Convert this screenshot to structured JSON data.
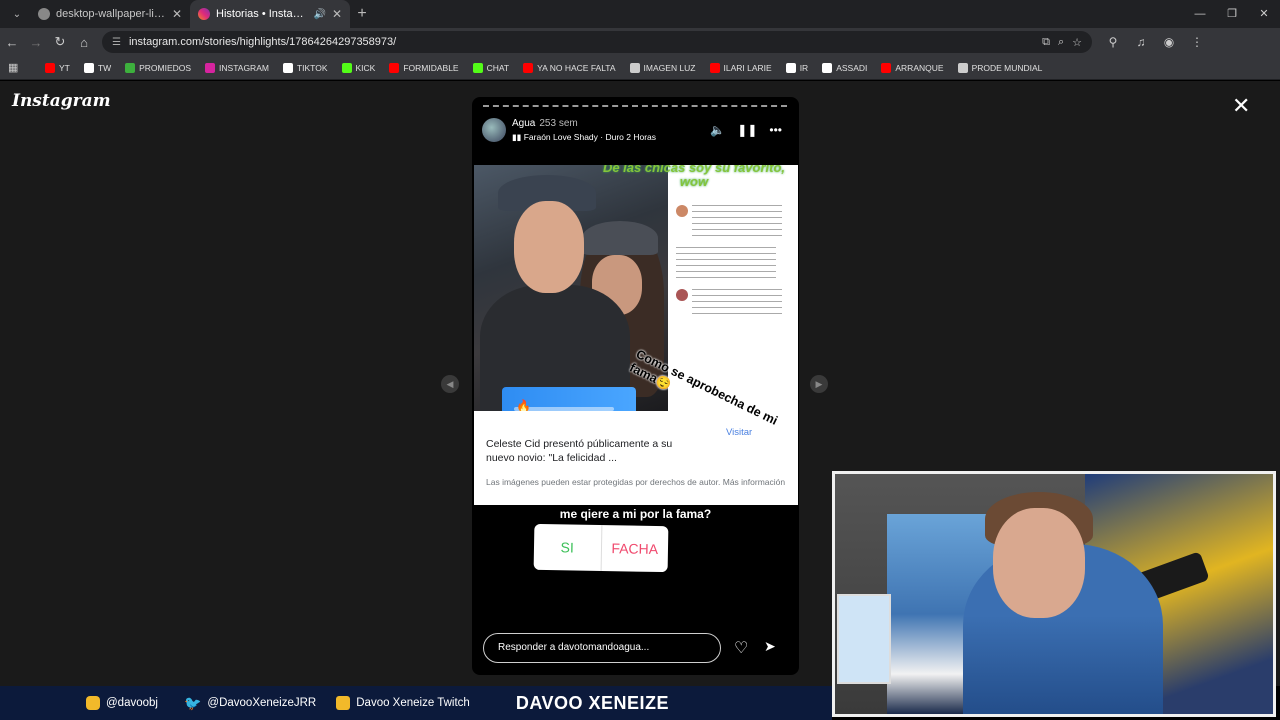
{
  "tabs": [
    {
      "title": "desktop-wallpaper-light-yellow"
    },
    {
      "title": "Historias • Instagram"
    }
  ],
  "address": {
    "url": "instagram.com/stories/highlights/17864264297358973/"
  },
  "bookmarks": [
    {
      "label": "YT",
      "color": "#ff0000"
    },
    {
      "label": "TW",
      "color": "#ffffff"
    },
    {
      "label": "PROMIEDOS",
      "color": "#3db03d"
    },
    {
      "label": "INSTAGRAM",
      "color": "#d6249f"
    },
    {
      "label": "TIKTOK",
      "color": "#ffffff"
    },
    {
      "label": "KICK",
      "color": "#53fc18"
    },
    {
      "label": "FORMIDABLE",
      "color": "#ff0000"
    },
    {
      "label": "CHAT",
      "color": "#53fc18"
    },
    {
      "label": "YA NO HACE FALTA",
      "color": "#ff0000"
    },
    {
      "label": "IMAGEN LUZ",
      "color": "#cccccc"
    },
    {
      "label": "ILARI LARIE",
      "color": "#ff0000"
    },
    {
      "label": "IR",
      "color": "#ffffff"
    },
    {
      "label": "ASSADI",
      "color": "#ffffff"
    },
    {
      "label": "ARRANQUE",
      "color": "#ff0000"
    },
    {
      "label": "PRODE MUNDIAL",
      "color": "#cccccc"
    }
  ],
  "instagram": {
    "logo": "Instagram"
  },
  "story": {
    "user": "Agua",
    "ago": "253 sem",
    "song": "Faraón Love Shady · Duro 2 Horas",
    "overlay_green": "De las chicas soy su favorito, wow",
    "caption_title": "Celeste Cid presentó públicamente a su nuevo novio: \"La felicidad ...",
    "caption_sub": "Las imágenes pueden estar protegidas por derechos de autor. Más información",
    "visit": "Visitar",
    "diagonal": "Como se aprobecha de mi fama😌",
    "question": "me qiere a mi por la fama?",
    "poll_yes": "SI",
    "poll_no": "FACHA",
    "reply_placeholder": "Responder a davotomandoagua..."
  },
  "footer": {
    "instagram": "@davoobj",
    "twitter": "@DavooXeneizeJRR",
    "twitch": "Davoo Xeneize Twitch",
    "name": "DAVOO XENEIZE"
  },
  "colors": {
    "bottom_bar": "#0c1a3b",
    "accent_green": "#86c43a",
    "poll_yes": "#3fc15b",
    "poll_no": "#f04a6e"
  }
}
